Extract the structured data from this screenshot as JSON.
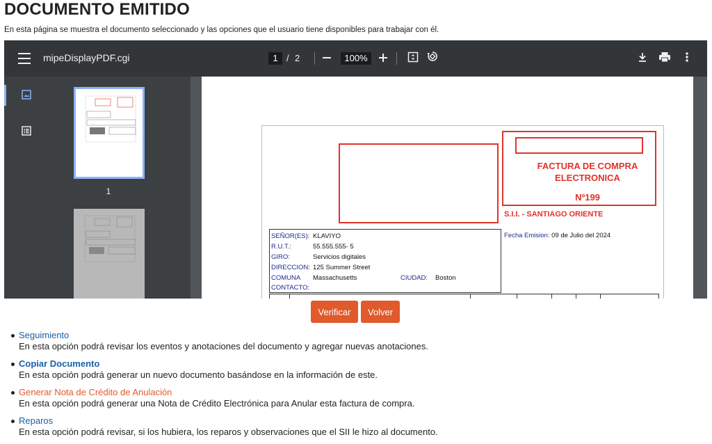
{
  "page": {
    "title": "DOCUMENTO EMITIDO",
    "description": "En esta página se muestra el documento seleccionado y las opciones que el usuario tiene disponibles para trabajar con él."
  },
  "viewer": {
    "filename": "mipeDisplayPDF.cgi",
    "current_page": "1",
    "page_separator": "/",
    "total_pages": "2",
    "zoom": "100%",
    "icons": {
      "menu": "menu-icon",
      "zoom_out": "minus-icon",
      "zoom_in": "plus-icon",
      "fit": "fit-page-icon",
      "rotate": "rotate-icon",
      "download": "download-icon",
      "print": "print-icon",
      "more": "more-vertical-icon"
    },
    "thumbnails": [
      {
        "label": "1",
        "active": true
      },
      {
        "label": "",
        "active": false
      }
    ]
  },
  "document": {
    "title_line1": "FACTURA DE COMPRA",
    "title_line2": "ELECTRONICA",
    "number": "Nº199",
    "sii_office": "S.I.I. - SANTIAGO ORIENTE",
    "fields": {
      "senor_label": "SEÑOR(ES):",
      "senor_value": "KLAVIYO",
      "rut_label": "R.U.T.:",
      "rut_value": "55.555.555- 5",
      "giro_label": "GIRO:",
      "giro_value": "Servicios digitales",
      "direccion_label": "DIRECCION:",
      "direccion_value": "125 Summer Street",
      "comuna_label": "COMUNA",
      "comuna_value": "Massachusetts",
      "ciudad_label": "CIUDAD:",
      "ciudad_value": "Boston",
      "contacto_label": "CONTACTO:"
    },
    "fecha_label": "Fecha Emision:",
    "fecha_value": "09 de Julio del 2024"
  },
  "buttons": {
    "verificar": "Verificar",
    "volver": "Volver"
  },
  "options": [
    {
      "title": "Seguimiento",
      "desc": "En esta opción podrá revisar los eventos y anotaciones del documento y agregar nuevas anotaciones.",
      "color": "#1a5fa8"
    },
    {
      "title": "Copiar Documento",
      "desc": "En esta opción podrá generar un nuevo documento basándose en la información de este.",
      "color": "#1a5fa8"
    },
    {
      "title": "Generar Nota de Crédito de Anulación",
      "desc": "En esta opción podrá generar una Nota de Crédito Electrónica para Anular esta factura de compra.",
      "color": "#e05a2b"
    },
    {
      "title": "Reparos",
      "desc": "En esta opción podrá revisar, si los hubiera, los reparos y observaciones que el SII le hizo al documento.",
      "color": "#1a5fa8"
    }
  ],
  "colors": {
    "accent_button": "#e05a2b",
    "link_blue": "#1a5fa8",
    "doc_red": "#e0332a"
  }
}
